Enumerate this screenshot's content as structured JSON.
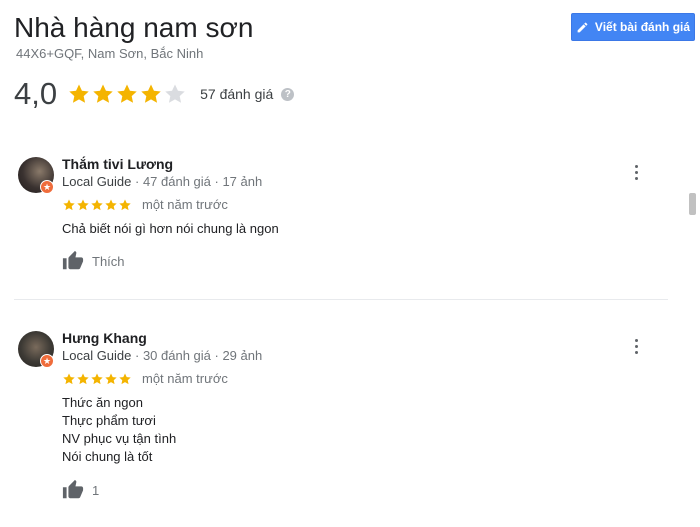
{
  "place": {
    "name": "Nhà hàng nam sơn",
    "address": "44X6+GQF, Nam Sơn, Bắc Ninh",
    "write_review_label": "Viết bài đánh giá",
    "rating": "4,0",
    "rating_value": 4,
    "review_count": "57 đánh giá"
  },
  "colors": {
    "star": "#f4b400",
    "star_empty": "#dadce0",
    "button": "#4285f4",
    "badge": "#ef6c3b"
  },
  "reviews": [
    {
      "author": "Thắm tivi Lương",
      "meta_guide": "Local Guide",
      "meta_rest": " · 47 đánh giá · 17 ảnh",
      "stars": 5,
      "time": "một năm trước",
      "lines": [
        "Chả biết nói gì hơn nói chung là ngon"
      ],
      "like_label": "Thích"
    },
    {
      "author": "Hưng Khang",
      "meta_guide": "Local Guide",
      "meta_rest": " · 30 đánh giá · 29 ảnh",
      "stars": 5,
      "time": "một năm trước",
      "lines": [
        "Thức ăn ngon",
        "Thực phẩm tươi",
        "NV phục vụ tận tình",
        "Nói chung là tốt"
      ],
      "like_label": "1"
    }
  ]
}
